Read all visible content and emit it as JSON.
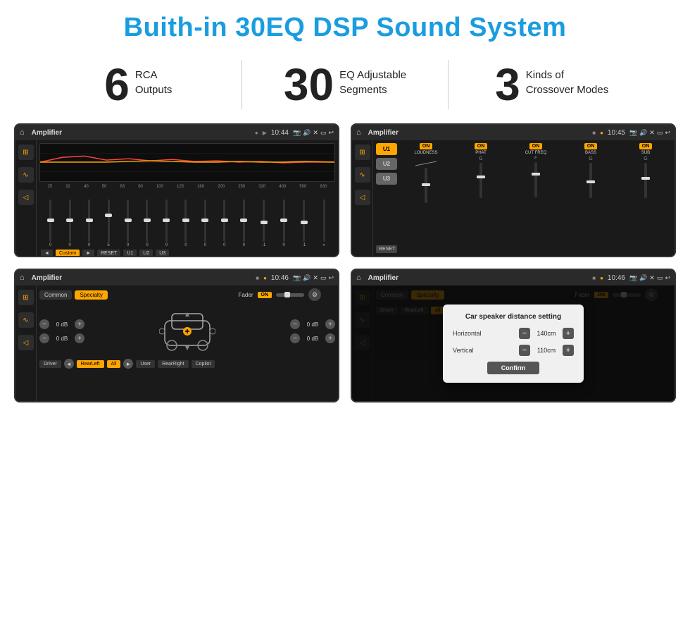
{
  "header": {
    "title": "Buith-in 30EQ DSP Sound System"
  },
  "stats": [
    {
      "number": "6",
      "line1": "RCA",
      "line2": "Outputs"
    },
    {
      "number": "30",
      "line1": "EQ Adjustable",
      "line2": "Segments"
    },
    {
      "number": "3",
      "line1": "Kinds of",
      "line2": "Crossover Modes"
    }
  ],
  "screens": {
    "eq": {
      "topbar": {
        "title": "Amplifier",
        "time": "10:44"
      },
      "freqs": [
        "25",
        "32",
        "40",
        "50",
        "63",
        "80",
        "100",
        "125",
        "160",
        "200",
        "250",
        "320",
        "400",
        "500",
        "630"
      ],
      "slider_vals": [
        "0",
        "0",
        "0",
        "5",
        "0",
        "0",
        "0",
        "0",
        "0",
        "0",
        "0",
        "-1",
        "0",
        "-1"
      ],
      "preset_buttons": [
        "Custom",
        "RESET",
        "U1",
        "U2",
        "U3"
      ]
    },
    "amp": {
      "topbar": {
        "title": "Amplifier",
        "time": "10:45"
      },
      "presets": [
        "U1",
        "U2",
        "U3"
      ],
      "controls": [
        "LOUDNESS",
        "PHAT",
        "CUT FREQ",
        "BASS",
        "SUB"
      ],
      "reset_label": "RESET"
    },
    "crossover": {
      "topbar": {
        "title": "Amplifier",
        "time": "10:46"
      },
      "tabs": [
        "Common",
        "Specialty"
      ],
      "fader_label": "Fader",
      "fader_on": "ON",
      "vol_rows": [
        {
          "label": "0 dB"
        },
        {
          "label": "0 dB"
        }
      ],
      "vol_rows_right": [
        {
          "label": "0 dB"
        },
        {
          "label": "0 dB"
        }
      ],
      "bottom_buttons": [
        "Driver",
        "RearLeft",
        "All",
        "User",
        "RearRight",
        "Copilot"
      ]
    },
    "dialog": {
      "topbar": {
        "title": "Amplifier",
        "time": "10:46"
      },
      "tabs": [
        "Common",
        "Specialty"
      ],
      "dialog": {
        "title": "Car speaker distance setting",
        "horizontal_label": "Horizontal",
        "horizontal_value": "140cm",
        "vertical_label": "Vertical",
        "vertical_value": "110cm",
        "confirm_label": "Confirm"
      },
      "bottom_buttons": [
        "Driver",
        "RearLeft",
        "All",
        "User",
        "RearRight",
        "Copilot"
      ]
    }
  }
}
